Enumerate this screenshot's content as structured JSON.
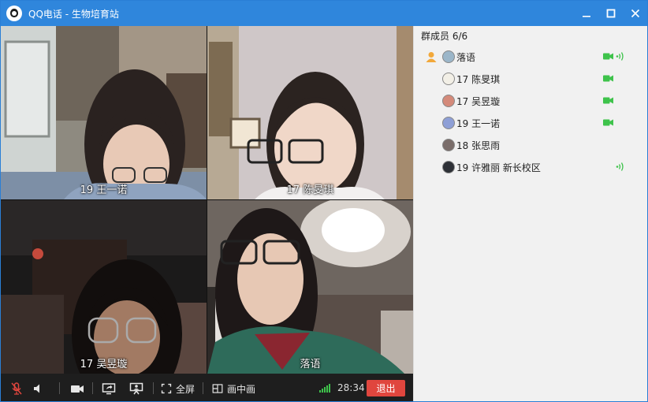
{
  "window": {
    "title": "QQ电话 - 生物培育站",
    "app_name": "QQ电话",
    "group_name": "生物培育站"
  },
  "videos": [
    {
      "label": "19 王一诺"
    },
    {
      "label": "17 陈旻琪"
    },
    {
      "label": "17 吴昱璇"
    },
    {
      "label": "落语"
    }
  ],
  "toolbar": {
    "fullscreen_label": "全屏",
    "pip_label": "画中画",
    "timer": "28:34",
    "exit_label": "退出"
  },
  "members_panel": {
    "header": "群成员 6/6",
    "members": [
      {
        "name": "落语",
        "host": true,
        "camera": true,
        "speaking": true
      },
      {
        "name": "17 陈旻琪",
        "host": false,
        "camera": true,
        "speaking": false
      },
      {
        "name": "17 吴昱璇",
        "host": false,
        "camera": true,
        "speaking": false
      },
      {
        "name": "19 王一诺",
        "host": false,
        "camera": true,
        "speaking": false
      },
      {
        "name": "18 张思雨",
        "host": false,
        "camera": false,
        "speaking": false
      },
      {
        "name": "19 许雅丽 新长校区",
        "host": false,
        "camera": false,
        "speaking": true
      }
    ]
  },
  "colors": {
    "titlebar": "#2f86dc",
    "exit": "#e0463e",
    "active_green": "#3ec34b",
    "mute_red": "#e0463e"
  }
}
